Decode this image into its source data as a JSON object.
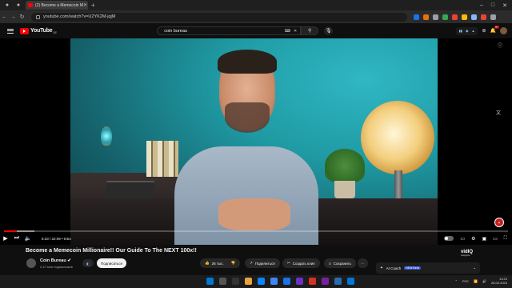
{
  "browser": {
    "tab_title": "(2) Become a Memecoin M",
    "url": "youtube.com/watch?v=U2YK2M-jqjM",
    "extensions": [
      "#1a73e8",
      "#e8710a",
      "#9aa0a6",
      "#34a853",
      "#ea4335",
      "#fbbc04",
      "#8ab4f8",
      "#ea4335",
      "#9aa0a6"
    ]
  },
  "youtube": {
    "logo_text": "YouTube",
    "country_code": "BE",
    "search_query": "coin bureau",
    "notifications_count": "9+"
  },
  "player": {
    "current_time": "5:33",
    "duration": "22:09",
    "chapter": "• Intro",
    "progress_played": 0.025,
    "progress_loaded": 0.06
  },
  "video": {
    "title": "Become a Memecoin Millionaire!! Our Guide To The NEXT 100x!!",
    "channel_name": "Coin Bureau",
    "subscribers": "2,47 млн подписчиков",
    "subscribe_label": "Подписаться",
    "likes": "26 тыс.",
    "share_label": "Поделиться",
    "clip_label": "Создать клип",
    "save_label": "Сохранить",
    "more_label": "···"
  },
  "vidiq": {
    "logo": "vidIQ",
    "subtitle": "Insights",
    "ai_coach_label": "AI Coach",
    "new_badge": "NEW Beta"
  },
  "taskbar": {
    "lang": "РУС",
    "time": "13:24",
    "date": "26.04.2024"
  }
}
